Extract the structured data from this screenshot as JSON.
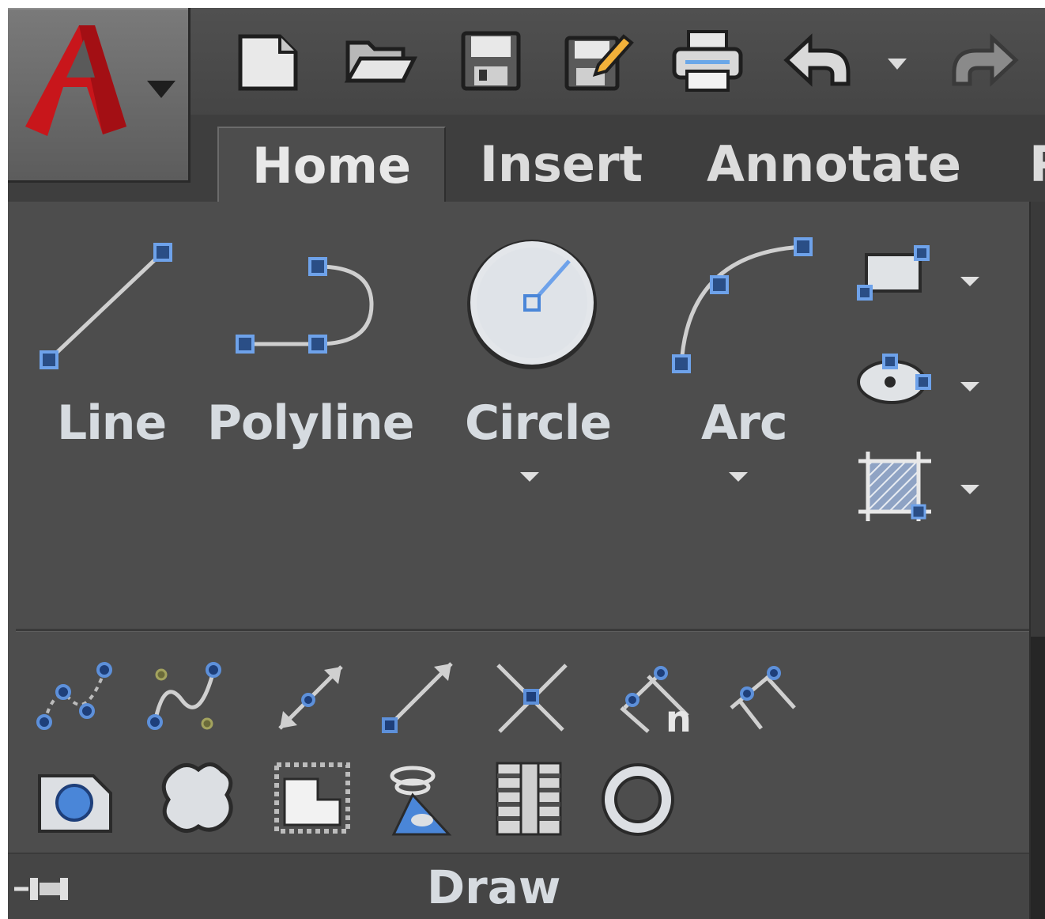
{
  "colors": {
    "background": "#4c4c4c",
    "accent_blue": "#4a86d8",
    "logo_red": "#c8161b",
    "label_text": "#d6dbe0"
  },
  "app_button": {
    "icon": "autocad-logo-icon",
    "has_dropdown": true
  },
  "quick_access": [
    {
      "name": "new-icon"
    },
    {
      "name": "open-icon"
    },
    {
      "name": "save-icon"
    },
    {
      "name": "save-as-icon"
    },
    {
      "name": "print-icon"
    },
    {
      "name": "undo-icon"
    },
    {
      "name": "undo-dropdown-icon"
    },
    {
      "name": "redo-icon"
    }
  ],
  "tabs": [
    {
      "label": "Home",
      "active": true
    },
    {
      "label": "Insert",
      "active": false
    },
    {
      "label": "Annotate",
      "active": false
    },
    {
      "label": "P",
      "active": false
    }
  ],
  "panel": {
    "title": "Draw",
    "large_tools": [
      {
        "label": "Line",
        "icon": "line-icon",
        "dropdown": false
      },
      {
        "label": "Polyline",
        "icon": "polyline-icon",
        "dropdown": false
      },
      {
        "label": "Circle",
        "icon": "circle-icon",
        "dropdown": true
      },
      {
        "label": "Arc",
        "icon": "arc-icon",
        "dropdown": true
      }
    ],
    "side_tools": [
      {
        "icon": "rectangle-icon",
        "dropdown": true
      },
      {
        "icon": "ellipse-icon",
        "dropdown": true
      },
      {
        "icon": "hatch-icon",
        "dropdown": true
      }
    ],
    "small_tools_row1": [
      "spline-fit-icon",
      "spline-cv-icon",
      "ray-icon",
      "construction-line-icon",
      "xline-icon",
      "divide-icon",
      "measure-icon"
    ],
    "small_tools_row2": [
      "region-icon",
      "revision-cloud-icon",
      "wipeout-icon",
      "helix-icon",
      "boundary-icon",
      "donut-icon"
    ],
    "pin_icon": "pin-icon"
  }
}
